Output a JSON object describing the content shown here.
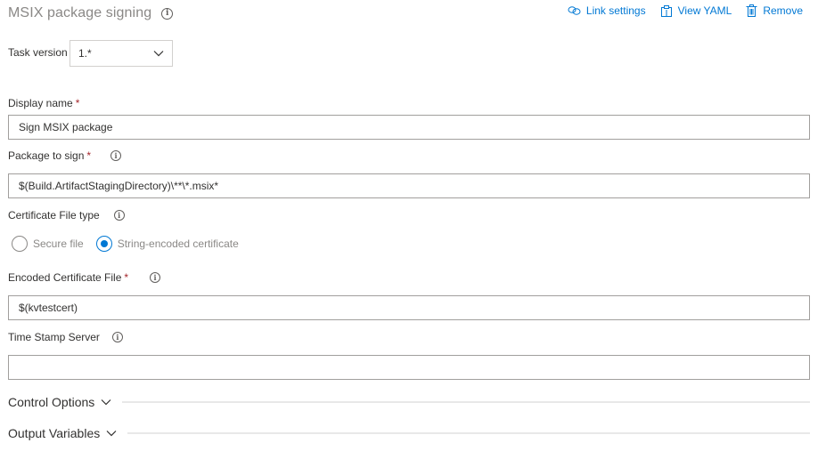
{
  "header": {
    "title": "MSIX package signing",
    "actions": [
      {
        "label": "Link settings",
        "icon": "link-icon"
      },
      {
        "label": "View YAML",
        "icon": "clipboard-icon"
      },
      {
        "label": "Remove",
        "icon": "trash-icon"
      }
    ]
  },
  "task_version": {
    "label": "Task version",
    "value": "1.*"
  },
  "fields": {
    "display_name": {
      "label": "Display name",
      "required": "*",
      "value": "Sign MSIX package"
    },
    "package_to_sign": {
      "label": "Package to sign",
      "required": "*",
      "value": "$(Build.ArtifactStagingDirectory)\\**\\*.msix*"
    },
    "certificate_file_type": {
      "label": "Certificate File type",
      "options": [
        {
          "label": "Secure file",
          "selected": false
        },
        {
          "label": "String-encoded certificate",
          "selected": true
        }
      ]
    },
    "encoded_certificate_file": {
      "label": "Encoded Certificate File",
      "required": "*",
      "value": "$(kvtestcert)"
    },
    "time_stamp_server": {
      "label": "Time Stamp Server",
      "value": ""
    }
  },
  "sections": [
    {
      "label": "Control Options"
    },
    {
      "label": "Output Variables"
    }
  ],
  "colors": {
    "accent": "#0078d4",
    "required": "#a4262c",
    "title": "#8a8886"
  }
}
